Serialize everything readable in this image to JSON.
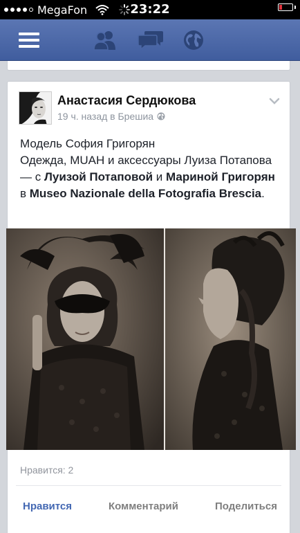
{
  "status_bar": {
    "carrier": "MegaFon",
    "time": "23:22",
    "battery_percent": 18,
    "signal_bars": 4,
    "icons": [
      "signal-dots-icon",
      "wifi-icon",
      "activity-spinner-icon",
      "battery-icon"
    ]
  },
  "navbar": {
    "icons": [
      "menu-icon",
      "friend-requests-icon",
      "messages-icon",
      "notifications-globe-icon"
    ]
  },
  "post": {
    "author": "Анастасия Сердюкова",
    "time_ago": "19 ч. назад в Брешиа",
    "privacy_icon": "public-globe-icon",
    "text_line1": "Модель София Григорян",
    "text_line2_a": "Одежда, MUAH и аксессуары Луиза Потапова — с ",
    "tag_1": "Луизой Потаповой",
    "text_and": " и ",
    "tag_2": "Мариной Григорян",
    "text_in": " в ",
    "tag_place": "Museo Nazionale della Fotografia Brescia",
    "text_end": ".",
    "likes_count": "Нравится: 2",
    "actions": {
      "like": "Нравится",
      "comment": "Комментарий",
      "share": "Поделиться"
    }
  },
  "colors": {
    "navbar": "#4c69aa",
    "like_blue": "#4267b2",
    "background": "#d3d6db"
  }
}
